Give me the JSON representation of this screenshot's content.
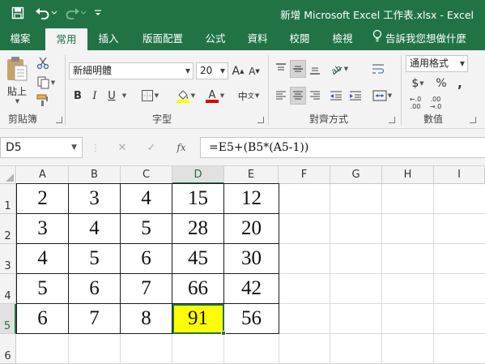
{
  "quick_access": {
    "save_icon": "save-icon",
    "undo_icon": "undo-icon",
    "redo_icon": "redo-icon",
    "customize_icon": "customize-toolbar-icon"
  },
  "window": {
    "title": "新增 Microsoft Excel 工作表.xlsx  -  Excel"
  },
  "ribbon_tabs": {
    "file": "檔案",
    "home": "常用",
    "insert": "插入",
    "page_layout": "版面配置",
    "formulas": "公式",
    "data": "資料",
    "review": "校閱",
    "view": "檢視",
    "tell_me": "告訴我您想做什麼"
  },
  "ribbon": {
    "clipboard": {
      "paste": "貼上",
      "label": "剪貼簿"
    },
    "font": {
      "name": "新細明體",
      "size": "20",
      "grow": "A",
      "shrink": "A",
      "bold": "B",
      "italic": "I",
      "underline": "U",
      "phonetic": "中",
      "label": "字型"
    },
    "alignment": {
      "label": "對齊方式"
    },
    "number": {
      "format": "通用格式",
      "currency": "$",
      "percent": "%",
      "comma": ",",
      "inc_decimal_top": "←.0",
      "inc_decimal_bottom": ".00",
      "dec_decimal_top": ".00",
      "dec_decimal_bottom": "→.0",
      "label": "數值"
    },
    "colors": {
      "fill": "#ffff00",
      "font": "#e00000",
      "brand": "#217346"
    }
  },
  "formula_bar": {
    "name_box": "D5",
    "cancel": "✕",
    "enter": "✓",
    "fx": "fx",
    "formula": "=E5+(B5*(A5-1))"
  },
  "sheet": {
    "columns": [
      "A",
      "B",
      "C",
      "D",
      "E",
      "F",
      "G",
      "H",
      "I"
    ],
    "rows": [
      "1",
      "2",
      "3",
      "4",
      "5",
      "6"
    ],
    "selected_cell": "D5",
    "highlight_color": "#ffff00",
    "data": [
      [
        "2",
        "3",
        "4",
        "15",
        "12"
      ],
      [
        "3",
        "4",
        "5",
        "28",
        "20"
      ],
      [
        "4",
        "5",
        "6",
        "45",
        "30"
      ],
      [
        "5",
        "6",
        "7",
        "66",
        "42"
      ],
      [
        "6",
        "7",
        "8",
        "91",
        "56"
      ]
    ]
  }
}
